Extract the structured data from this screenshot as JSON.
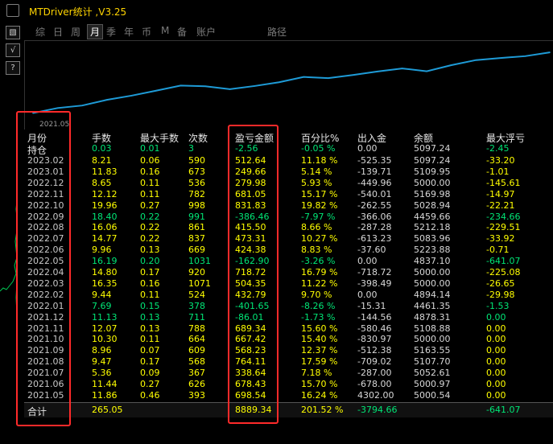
{
  "window": {
    "title": "MTDriver统计 ,V3.25"
  },
  "left_buttons": [
    "▧",
    "√",
    "?"
  ],
  "tabs": [
    {
      "label": "综",
      "active": false
    },
    {
      "label": "日",
      "active": false
    },
    {
      "label": "周",
      "active": false
    },
    {
      "label": "月",
      "active": true
    },
    {
      "label": "季",
      "active": false
    },
    {
      "label": "年",
      "active": false
    },
    {
      "label": "币",
      "active": false
    },
    {
      "label": "M",
      "active": false
    },
    {
      "label": "备",
      "active": false
    },
    {
      "label": "账户",
      "active": false
    },
    {
      "label": "路径",
      "active": false
    }
  ],
  "chart_data": {
    "type": "line",
    "x_label_start": "2021.05",
    "x": [
      "2021.05",
      "2021.06",
      "2021.07",
      "2021.08",
      "2021.09",
      "2021.10",
      "2021.11",
      "2021.12",
      "2022.01",
      "2022.02",
      "2022.03",
      "2022.04",
      "2022.05",
      "2022.06",
      "2022.07",
      "2022.08",
      "2022.09",
      "2022.10",
      "2022.11",
      "2022.12",
      "2023.01",
      "2023.02"
    ],
    "values": [
      4302.0,
      5000.97,
      5052.61,
      5107.7,
      5163.55,
      5000.0,
      5108.88,
      4878.31,
      4461.35,
      4894.14,
      5000.0,
      5000.0,
      4837.1,
      5223.88,
      5083.96,
      5212.18,
      4459.66,
      5028.94,
      5169.98,
      5000.0,
      5109.95,
      5097.24
    ],
    "color": "#1e9bd7"
  },
  "table": {
    "headers": [
      "月份",
      "手数",
      "最大手数",
      "次数",
      "盈亏金额",
      "百分比%",
      "出入金",
      "余额",
      "最大浮亏"
    ],
    "position": {
      "label": "持仓",
      "lots": "0.03",
      "max_lots": "0.01",
      "count": "3",
      "pnl": "-2.56",
      "pct": "-0.05 %",
      "deposit": "0.00",
      "balance": "5097.24",
      "max_dd": "-2.45"
    },
    "rows": [
      {
        "month": "2023.02",
        "lots": "8.21",
        "max_lots": "0.06",
        "count": "590",
        "pnl": "512.64",
        "pct": "11.18 %",
        "deposit": "-525.35",
        "balance": "5097.24",
        "max_dd": "-33.20",
        "pos": true
      },
      {
        "month": "2023.01",
        "lots": "11.83",
        "max_lots": "0.16",
        "count": "673",
        "pnl": "249.66",
        "pct": "5.14 %",
        "deposit": "-139.71",
        "balance": "5109.95",
        "max_dd": "-1.01",
        "pos": true
      },
      {
        "month": "2022.12",
        "lots": "8.65",
        "max_lots": "0.11",
        "count": "536",
        "pnl": "279.98",
        "pct": "5.93 %",
        "deposit": "-449.96",
        "balance": "5000.00",
        "max_dd": "-145.61",
        "pos": true
      },
      {
        "month": "2022.11",
        "lots": "12.12",
        "max_lots": "0.11",
        "count": "782",
        "pnl": "681.05",
        "pct": "15.17 %",
        "deposit": "-540.01",
        "balance": "5169.98",
        "max_dd": "-14.97",
        "pos": true
      },
      {
        "month": "2022.10",
        "lots": "19.96",
        "max_lots": "0.27",
        "count": "998",
        "pnl": "831.83",
        "pct": "19.82 %",
        "deposit": "-262.55",
        "balance": "5028.94",
        "max_dd": "-22.21",
        "pos": true
      },
      {
        "month": "2022.09",
        "lots": "18.40",
        "max_lots": "0.22",
        "count": "991",
        "pnl": "-386.46",
        "pct": "-7.97 %",
        "deposit": "-366.06",
        "balance": "4459.66",
        "max_dd": "-234.66",
        "pos": false
      },
      {
        "month": "2022.08",
        "lots": "16.06",
        "max_lots": "0.22",
        "count": "861",
        "pnl": "415.50",
        "pct": "8.66 %",
        "deposit": "-287.28",
        "balance": "5212.18",
        "max_dd": "-229.51",
        "pos": true
      },
      {
        "month": "2022.07",
        "lots": "14.77",
        "max_lots": "0.22",
        "count": "837",
        "pnl": "473.31",
        "pct": "10.27 %",
        "deposit": "-613.23",
        "balance": "5083.96",
        "max_dd": "-33.92",
        "pos": true
      },
      {
        "month": "2022.06",
        "lots": "9.96",
        "max_lots": "0.13",
        "count": "669",
        "pnl": "424.38",
        "pct": "8.83 %",
        "deposit": "-37.60",
        "balance": "5223.88",
        "max_dd": "-0.71",
        "pos": true
      },
      {
        "month": "2022.05",
        "lots": "16.19",
        "max_lots": "0.20",
        "count": "1031",
        "pnl": "-162.90",
        "pct": "-3.26 %",
        "deposit": "0.00",
        "balance": "4837.10",
        "max_dd": "-641.07",
        "pos": false
      },
      {
        "month": "2022.04",
        "lots": "14.80",
        "max_lots": "0.17",
        "count": "920",
        "pnl": "718.72",
        "pct": "16.79 %",
        "deposit": "-718.72",
        "balance": "5000.00",
        "max_dd": "-225.08",
        "pos": true
      },
      {
        "month": "2022.03",
        "lots": "16.35",
        "max_lots": "0.16",
        "count": "1071",
        "pnl": "504.35",
        "pct": "11.22 %",
        "deposit": "-398.49",
        "balance": "5000.00",
        "max_dd": "-26.65",
        "pos": true
      },
      {
        "month": "2022.02",
        "lots": "9.44",
        "max_lots": "0.11",
        "count": "524",
        "pnl": "432.79",
        "pct": "9.70 %",
        "deposit": "0.00",
        "balance": "4894.14",
        "max_dd": "-29.98",
        "pos": true
      },
      {
        "month": "2022.01",
        "lots": "7.69",
        "max_lots": "0.15",
        "count": "378",
        "pnl": "-401.65",
        "pct": "-8.26 %",
        "deposit": "-15.31",
        "balance": "4461.35",
        "max_dd": "-1.53",
        "pos": false
      },
      {
        "month": "2021.12",
        "lots": "11.13",
        "max_lots": "0.13",
        "count": "711",
        "pnl": "-86.01",
        "pct": "-1.73 %",
        "deposit": "-144.56",
        "balance": "4878.31",
        "max_dd": "0.00",
        "pos": false
      },
      {
        "month": "2021.11",
        "lots": "12.07",
        "max_lots": "0.13",
        "count": "788",
        "pnl": "689.34",
        "pct": "15.60 %",
        "deposit": "-580.46",
        "balance": "5108.88",
        "max_dd": "0.00",
        "pos": true
      },
      {
        "month": "2021.10",
        "lots": "10.30",
        "max_lots": "0.11",
        "count": "664",
        "pnl": "667.42",
        "pct": "15.40 %",
        "deposit": "-830.97",
        "balance": "5000.00",
        "max_dd": "0.00",
        "pos": true
      },
      {
        "month": "2021.09",
        "lots": "8.96",
        "max_lots": "0.07",
        "count": "609",
        "pnl": "568.23",
        "pct": "12.37 %",
        "deposit": "-512.38",
        "balance": "5163.55",
        "max_dd": "0.00",
        "pos": true
      },
      {
        "month": "2021.08",
        "lots": "9.47",
        "max_lots": "0.17",
        "count": "568",
        "pnl": "764.11",
        "pct": "17.59 %",
        "deposit": "-709.02",
        "balance": "5107.70",
        "max_dd": "0.00",
        "pos": true
      },
      {
        "month": "2021.07",
        "lots": "5.36",
        "max_lots": "0.09",
        "count": "367",
        "pnl": "338.64",
        "pct": "7.18 %",
        "deposit": "-287.00",
        "balance": "5052.61",
        "max_dd": "0.00",
        "pos": true
      },
      {
        "month": "2021.06",
        "lots": "11.44",
        "max_lots": "0.27",
        "count": "626",
        "pnl": "678.43",
        "pct": "15.70 %",
        "deposit": "-678.00",
        "balance": "5000.97",
        "max_dd": "0.00",
        "pos": true
      },
      {
        "month": "2021.05",
        "lots": "11.86",
        "max_lots": "0.46",
        "count": "393",
        "pnl": "698.54",
        "pct": "16.24 %",
        "deposit": "4302.00",
        "balance": "5000.54",
        "max_dd": "0.00",
        "pos": true
      }
    ],
    "total": {
      "label": "合计",
      "lots": "265.05",
      "pnl": "8889.34",
      "pct": "201.52 %",
      "deposit": "-3794.66",
      "max_dd": "-641.07"
    }
  },
  "highlight_color": "#ff2a2a"
}
